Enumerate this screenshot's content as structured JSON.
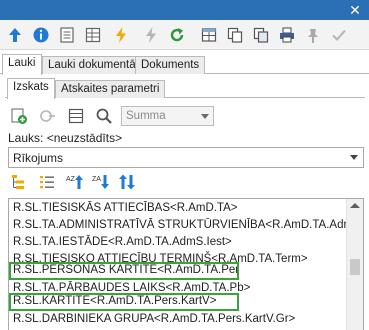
{
  "window": {
    "close_glyph": "✕"
  },
  "toolbar": {
    "icons": [
      "arrow-up-icon",
      "info-icon",
      "document-icon",
      "spreadsheet-icon",
      "lightning-icon",
      "lightning-disabled-icon",
      "refresh-icon",
      "table-icon",
      "copy-icon",
      "printer-icon",
      "pin-icon",
      "check-icon"
    ]
  },
  "outer_tabs": [
    {
      "label": "Lauki",
      "active": true
    },
    {
      "label": "Lauki dokumentā",
      "active": false
    },
    {
      "label": "Dokuments",
      "active": false
    }
  ],
  "inner_tabs": [
    {
      "label": "Izskats",
      "active": true
    },
    {
      "label": "Atskaites parametri",
      "active": false
    }
  ],
  "field_tools": {
    "icons": [
      "add-icon",
      "add-disabled-icon",
      "filter-icon",
      "search-icon"
    ],
    "aggregate": {
      "value": "Summa"
    }
  },
  "fields": {
    "label": "Lauks: <neuzstādīts>",
    "selected": "Rīkojums"
  },
  "sort_tools": {
    "icons": [
      "sort-tree-icon",
      "list-icon",
      "sort-az-icon",
      "sort-za-icon",
      "sort-vertical-icon"
    ],
    "az_text": "AZ",
    "za_text": "ZA"
  },
  "list": {
    "items": [
      {
        "text": "R.SL.TIESISKĀS ATTIECĪBAS<R.AmD.TA>",
        "highlighted": false
      },
      {
        "text": "R.SL.TA.ADMINISTRATĪVĀ STRUKTŪRVIENĪBA<R.AmD.TA.AdmS>",
        "highlighted": false
      },
      {
        "text": "R.SL.TA.IESTĀDE<R.AmD.TA.AdmS.Iest>",
        "highlighted": false
      },
      {
        "text": "R.SL.TIESISKO ATTIECĪBU TERMIŅŠ<R.AmD.TA.Term>",
        "highlighted": false
      },
      {
        "text": "R.SL.PERSONAS KARTĪTE<R.AmD.TA.Pers>",
        "highlighted": true
      },
      {
        "text": "R.SL.TA.PĀRBAUDES LAIKS<R.AmD.TA.Pb>",
        "highlighted": false
      },
      {
        "text": "R.SL.KARTĪTE<R.AmD.TA.Pers.KartV>",
        "highlighted": true
      },
      {
        "text": "R.SL.DARBINIEKA GRUPA<R.AmD.TA.Pers.KartV.Gr>",
        "highlighted": false
      }
    ]
  },
  "colors": {
    "titlebar": "#2b6fb5",
    "highlight": "#3aa33a",
    "accent_blue": "#1f7ad6",
    "lightning": "#f2a900"
  }
}
